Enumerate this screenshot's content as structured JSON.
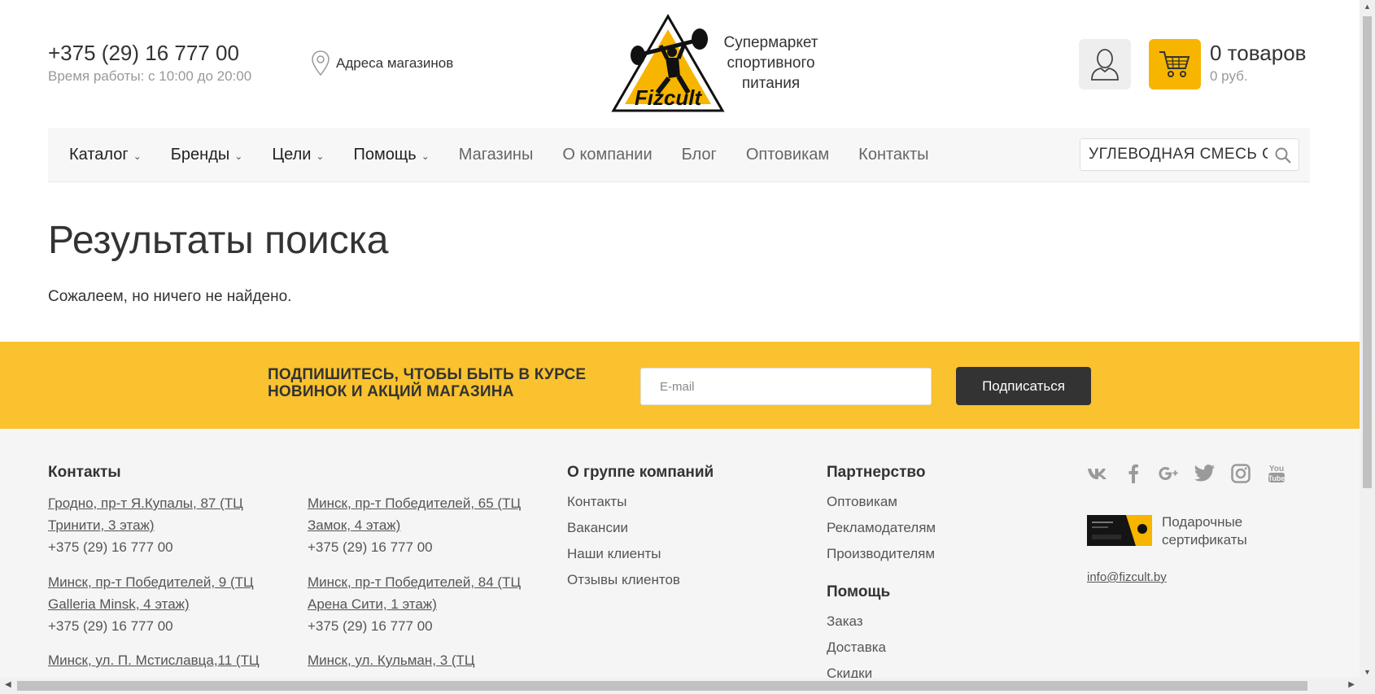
{
  "header": {
    "phone": "+375 (29) 16 777 00",
    "hours": "Время работы: с 10:00 до 20:00",
    "stores_link": "Адреса магазинов",
    "logo_text": "Fizcult",
    "tagline_line1": "Супермаркет",
    "tagline_line2": "спортивного",
    "tagline_line3": "питания",
    "cart_count": "0 товаров",
    "cart_sum": "0 руб."
  },
  "nav": {
    "items": [
      {
        "label": "Каталог",
        "dropdown": true
      },
      {
        "label": "Бренды",
        "dropdown": true
      },
      {
        "label": "Цели",
        "dropdown": true
      },
      {
        "label": "Помощь",
        "dropdown": true
      },
      {
        "label": "Магазины",
        "dropdown": false
      },
      {
        "label": "О компании",
        "dropdown": false
      },
      {
        "label": "Блог",
        "dropdown": false
      },
      {
        "label": "Оптовикам",
        "dropdown": false
      },
      {
        "label": "Контакты",
        "dropdown": false
      }
    ],
    "search_value": "УГЛЕВОДНАЯ СМЕСЬ С"
  },
  "main": {
    "title": "Результаты поиска",
    "message": "Сожалеем, но ничего не найдено."
  },
  "subscribe": {
    "line1": "ПОДПИШИТЕСЬ, ЧТОБЫ БЫТЬ В КУРСЕ",
    "line2": "НОВИНОК И АКЦИЙ МАГАЗИНА",
    "email_placeholder": "E-mail",
    "button": "Подписаться"
  },
  "footer": {
    "contacts_title": "Контакты",
    "addresses": [
      {
        "address": "Гродно, пр-т Я.Купалы, 87 (ТЦ Тринити, 3 этаж)",
        "phone": "+375 (29) 16 777 00"
      },
      {
        "address": "Минск, пр-т Победителей, 65 (ТЦ Замок, 4 этаж)",
        "phone": "+375 (29) 16 777 00"
      },
      {
        "address": "Минск, пр-т Победителей, 9 (ТЦ Galleria Minsk, 4 этаж)",
        "phone": "+375 (29) 16 777 00"
      },
      {
        "address": "Минск, пр-т Победителей, 84 (ТЦ Арена Сити, 1 этаж)",
        "phone": "+375 (29) 16 777 00"
      },
      {
        "address": "Минск, ул. П. Мстиславца,11 (ТЦ",
        "phone": ""
      },
      {
        "address": "Минск, ул. Кульман, 3 (ТЦ",
        "phone": ""
      }
    ],
    "about_title": "О группе компаний",
    "about_links": [
      "Контакты",
      "Вакансии",
      "Наши клиенты",
      "Отзывы клиентов"
    ],
    "partner_title": "Партнерство",
    "partner_links": [
      "Оптовикам",
      "Рекламодателям",
      "Производителям"
    ],
    "help_title": "Помощь",
    "help_links": [
      "Заказ",
      "Доставка",
      "Скидки"
    ],
    "social_icons": [
      "vk-icon",
      "facebook-icon",
      "google-plus-icon",
      "twitter-icon",
      "instagram-icon",
      "youtube-icon"
    ],
    "gift_line1": "Подарочные",
    "gift_line2": "сертификаты",
    "email": "info@fizcult.by"
  },
  "colors": {
    "accent": "#f7b500",
    "subscribe_bg": "#f9c22e",
    "dark_button": "#333333",
    "footer_bg": "#f5f5f5"
  }
}
